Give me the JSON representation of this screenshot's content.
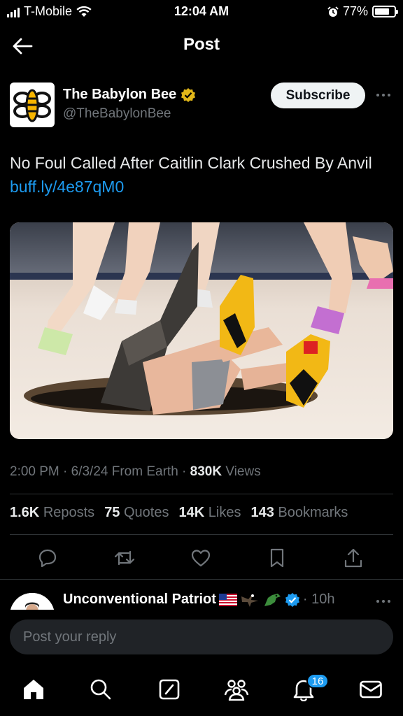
{
  "status_bar": {
    "carrier": "T-Mobile",
    "time": "12:04 AM",
    "battery": "77%",
    "battery_level": 0.77
  },
  "header": {
    "title": "Post"
  },
  "post": {
    "author_name": "The Babylon Bee",
    "author_handle": "@TheBabylonBee",
    "subscribe_label": "Subscribe",
    "text": "No Foul Called After Caitlin Clark Crushed By Anvil ",
    "link": "buff.ly/4e87qM0",
    "timestamp": "2:00 PM · 6/3/24 From Earth · ",
    "views_count": "830K",
    "views_label": " Views"
  },
  "stats": {
    "reposts_count": "1.6K",
    "reposts_label": "Reposts",
    "quotes_count": "75",
    "quotes_label": "Quotes",
    "likes_count": "14K",
    "likes_label": "Likes",
    "bookmarks_count": "143",
    "bookmarks_label": "Bookmarks"
  },
  "reply_preview": {
    "name": "Unconventional Patriot",
    "time": "· 10h"
  },
  "reply_bar": {
    "placeholder": "Post your reply"
  },
  "bottom_nav": {
    "notifications_badge": "16"
  },
  "colors": {
    "accent": "#1d9bf0",
    "verified_gold": "#e2b719",
    "background": "#000000"
  },
  "icons": [
    "back-arrow-icon",
    "verified-gold-icon",
    "more-icon",
    "reply-icon",
    "repost-icon",
    "like-icon",
    "bookmark-icon",
    "share-icon",
    "home-icon",
    "search-icon",
    "grok-icon",
    "communities-icon",
    "notifications-icon",
    "messages-icon"
  ]
}
